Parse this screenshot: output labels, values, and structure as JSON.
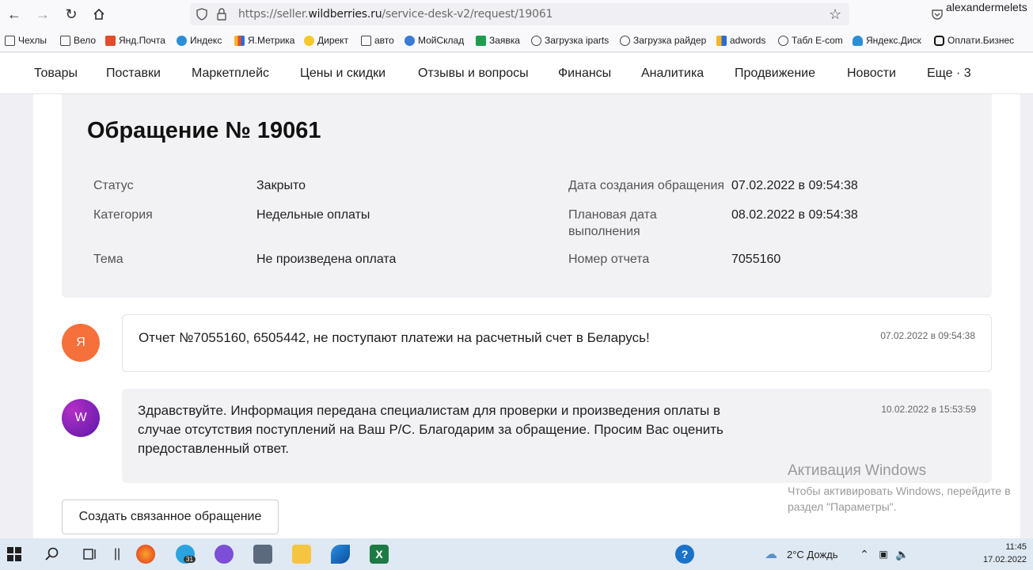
{
  "browser": {
    "url_prefix": "https://seller.",
    "url_domain": "wildberries.ru",
    "url_path": "/service-desk-v2/request/19061",
    "user": "alexandermelets"
  },
  "bookmarks": [
    "Чехлы",
    "Вело",
    "Янд.Почта",
    "Индекс",
    "Я.Метрика",
    "Директ",
    "авто",
    "МойСклад",
    "Заявка",
    "Загрузка iparts",
    "Загрузка райдер",
    "adwords",
    "Табл E-com",
    "Яндекс.Диск",
    "Оплати.Бизнес"
  ],
  "nav": [
    "Товары",
    "Поставки",
    "Маркетплейс",
    "Цены и скидки",
    "Отзывы и вопросы",
    "Финансы",
    "Аналитика",
    "Продвижение",
    "Новости",
    "Еще · 3"
  ],
  "request": {
    "title": "Обращение № 19061",
    "status_label": "Статус",
    "status_value": "Закрыто",
    "category_label": "Категория",
    "category_value": "Недельные оплаты",
    "topic_label": "Тема",
    "topic_value": "Не произведена оплата",
    "created_label": "Дата создания обращения",
    "created_value": "07.02.2022 в 09:54:38",
    "planned_label_1": "Плановая дата",
    "planned_label_2": "выполнения",
    "planned_value": "08.02.2022 в 09:54:38",
    "report_label": "Номер отчета",
    "report_value": "7055160"
  },
  "messages": [
    {
      "avatar": "Я",
      "avatar_color": "#f5703a",
      "text": "Отчет №7055160, 6505442, не поступают платежи на расчетный счет в Беларусь!",
      "date": "07.02.2022 в 09:54:38"
    },
    {
      "avatar": "W",
      "avatar_color": "#8a1fa6",
      "line1": "Здравствуйте. Информация передана специалистам для проверки и произведения оплаты в",
      "line2": "случае отсутствия поступлений на Ваш Р/С. Благодарим за обращение. Просим Вас оценить",
      "line3": "предоставленный ответ.",
      "date": "10.02.2022 в 15:53:59"
    }
  ],
  "create_button": "Создать связанное обращение",
  "watermark": {
    "title": "Активация Windows",
    "line1": "Чтобы активировать Windows, перейдите в",
    "line2": "раздел \"Параметры\"."
  },
  "taskbar": {
    "weather": "2°C  Дождь",
    "time": "11:45",
    "date": "17.02.2022",
    "badge": "31"
  }
}
